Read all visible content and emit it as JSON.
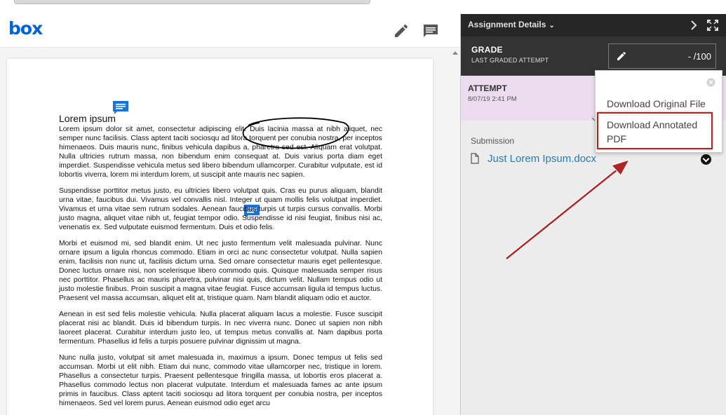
{
  "app": {
    "logo_text": "box",
    "brand_color": "#0061d5"
  },
  "toolbar": {
    "icons": [
      "pencil-icon",
      "comment-icon"
    ]
  },
  "document": {
    "heading": "Lorem ipsum",
    "paragraphs": [
      "Lorem ipsum dolor sit amet, consectetur adipiscing elit. Duis lacinia massa at nibh aliquet, nec semper nunc facilisis. Class aptent taciti sociosqu ad litora torquent per conubia nostra, per inceptos himenaeos. Duis mauris nunc, finibus vehicula dapibus a, pharetra sed est. Aliquam erat volutpat. Nulla ultricies rutrum massa, non bibendum enim consequat at. Duis varius porta diam eget imperdiet. Suspendisse vehicula metus sed libero bibendum ullamcorper. Curabitur vulputate, est id lobortis viverra, lorem mi interdum lorem, ut suscipit ante mauris nec sapien.",
      "Suspendisse porttitor metus justo, eu ultricies libero volutpat quis. Cras eu purus aliquam, blandit urna vitae, faucibus dui. Vivamus vel convallis nisl. Integer ut quam mollis felis volutpat imperdiet. Vivamus et urna vitae sem rutrum sodales. Aenean faucibus turpis ut turpis cursus convallis. Morbi justo magna, aliquet vitae nibh ut, feugiat tempor odio. Suspendisse id nisi feugiat, finibus nisi ac, venenatis ex. Sed vulputate euismod fermentum. Duis et odio felis.",
      "Morbi et euismod mi, sed blandit enim. Ut nec justo fermentum velit malesuada pulvinar. Nunc ornare ipsum a ligula rhoncus commodo. Etiam in orci ac nunc consectetur volutpat. Nulla sapien enim, facilisis non nunc ut, facilisis dictum urna. Sed ornare consectetur mauris eget pellentesque. Donec luctus ornare nisi, non scelerisque libero commodo quis. Quisque malesuada semper risus nec porttitor. Phasellus ac mauris pharetra, pulvinar nisi quis, dictum velit. Nullam tempus odio ut justo molestie finibus. Proin suscipit a magna vitae feugiat. Fusce accumsan ligula id tempus luctus. Praesent vel massa accumsan, aliquet elit at, tristique quam. Nam blandit aliquam odio et auctor.",
      "Aenean in est sed felis molestie vehicula. Nulla placerat aliquam lacus a molestie. Fusce suscipit placerat nisi ac blandit. Duis id bibendum turpis. In nec viverra nunc. Donec ut sapien non nibh laoreet placerat. Curabitur interdum justo leo, ut tempus metus convallis at. Nam dapibus porta fermentum. Phasellus id felis a turpis posuere pulvinar dignissim ut magna.",
      "Nunc nulla justo, volutpat sit amet malesuada in, maximus a ipsum. Donec tempus ut felis sed accumsan. Morbi ut elit nibh. Etiam dui nunc, commodo vitae ullamcorper nec, tristique in lorem. Phasellus a consectetur turpis. Praesent pellentesque fringilla massa, ut lobortis eros placerat a. Phasellus commodo lectus non placerat vulputate. Interdum et malesuada fames ac ante ipsum primis in faucibus. Class aptent taciti sociosqu ad litora torquent per conubia nostra, per inceptos himenaeos. Sed vel lorem purus. Aenean euismod odio eget arcu"
    ]
  },
  "panel": {
    "title": "Assignment Details",
    "grade": {
      "label": "GRADE",
      "sub_label": "LAST GRADED ATTEMPT",
      "value": "-",
      "out_of": "/100"
    },
    "attempt": {
      "label": "ATTEMPT",
      "date": "8/07/19 2:41 PM"
    },
    "submission": {
      "label": "Submission",
      "file_name": "Just Lorem Ipsum.docx"
    }
  },
  "dropdown": {
    "items": [
      "Download Original File",
      "Download Annotated PDF"
    ]
  },
  "colors": {
    "panel_header": "#262626",
    "grade_row": "#333333",
    "attempt_row": "#ecdcf0",
    "link": "#2a7ab0",
    "highlight": "#b02626"
  }
}
